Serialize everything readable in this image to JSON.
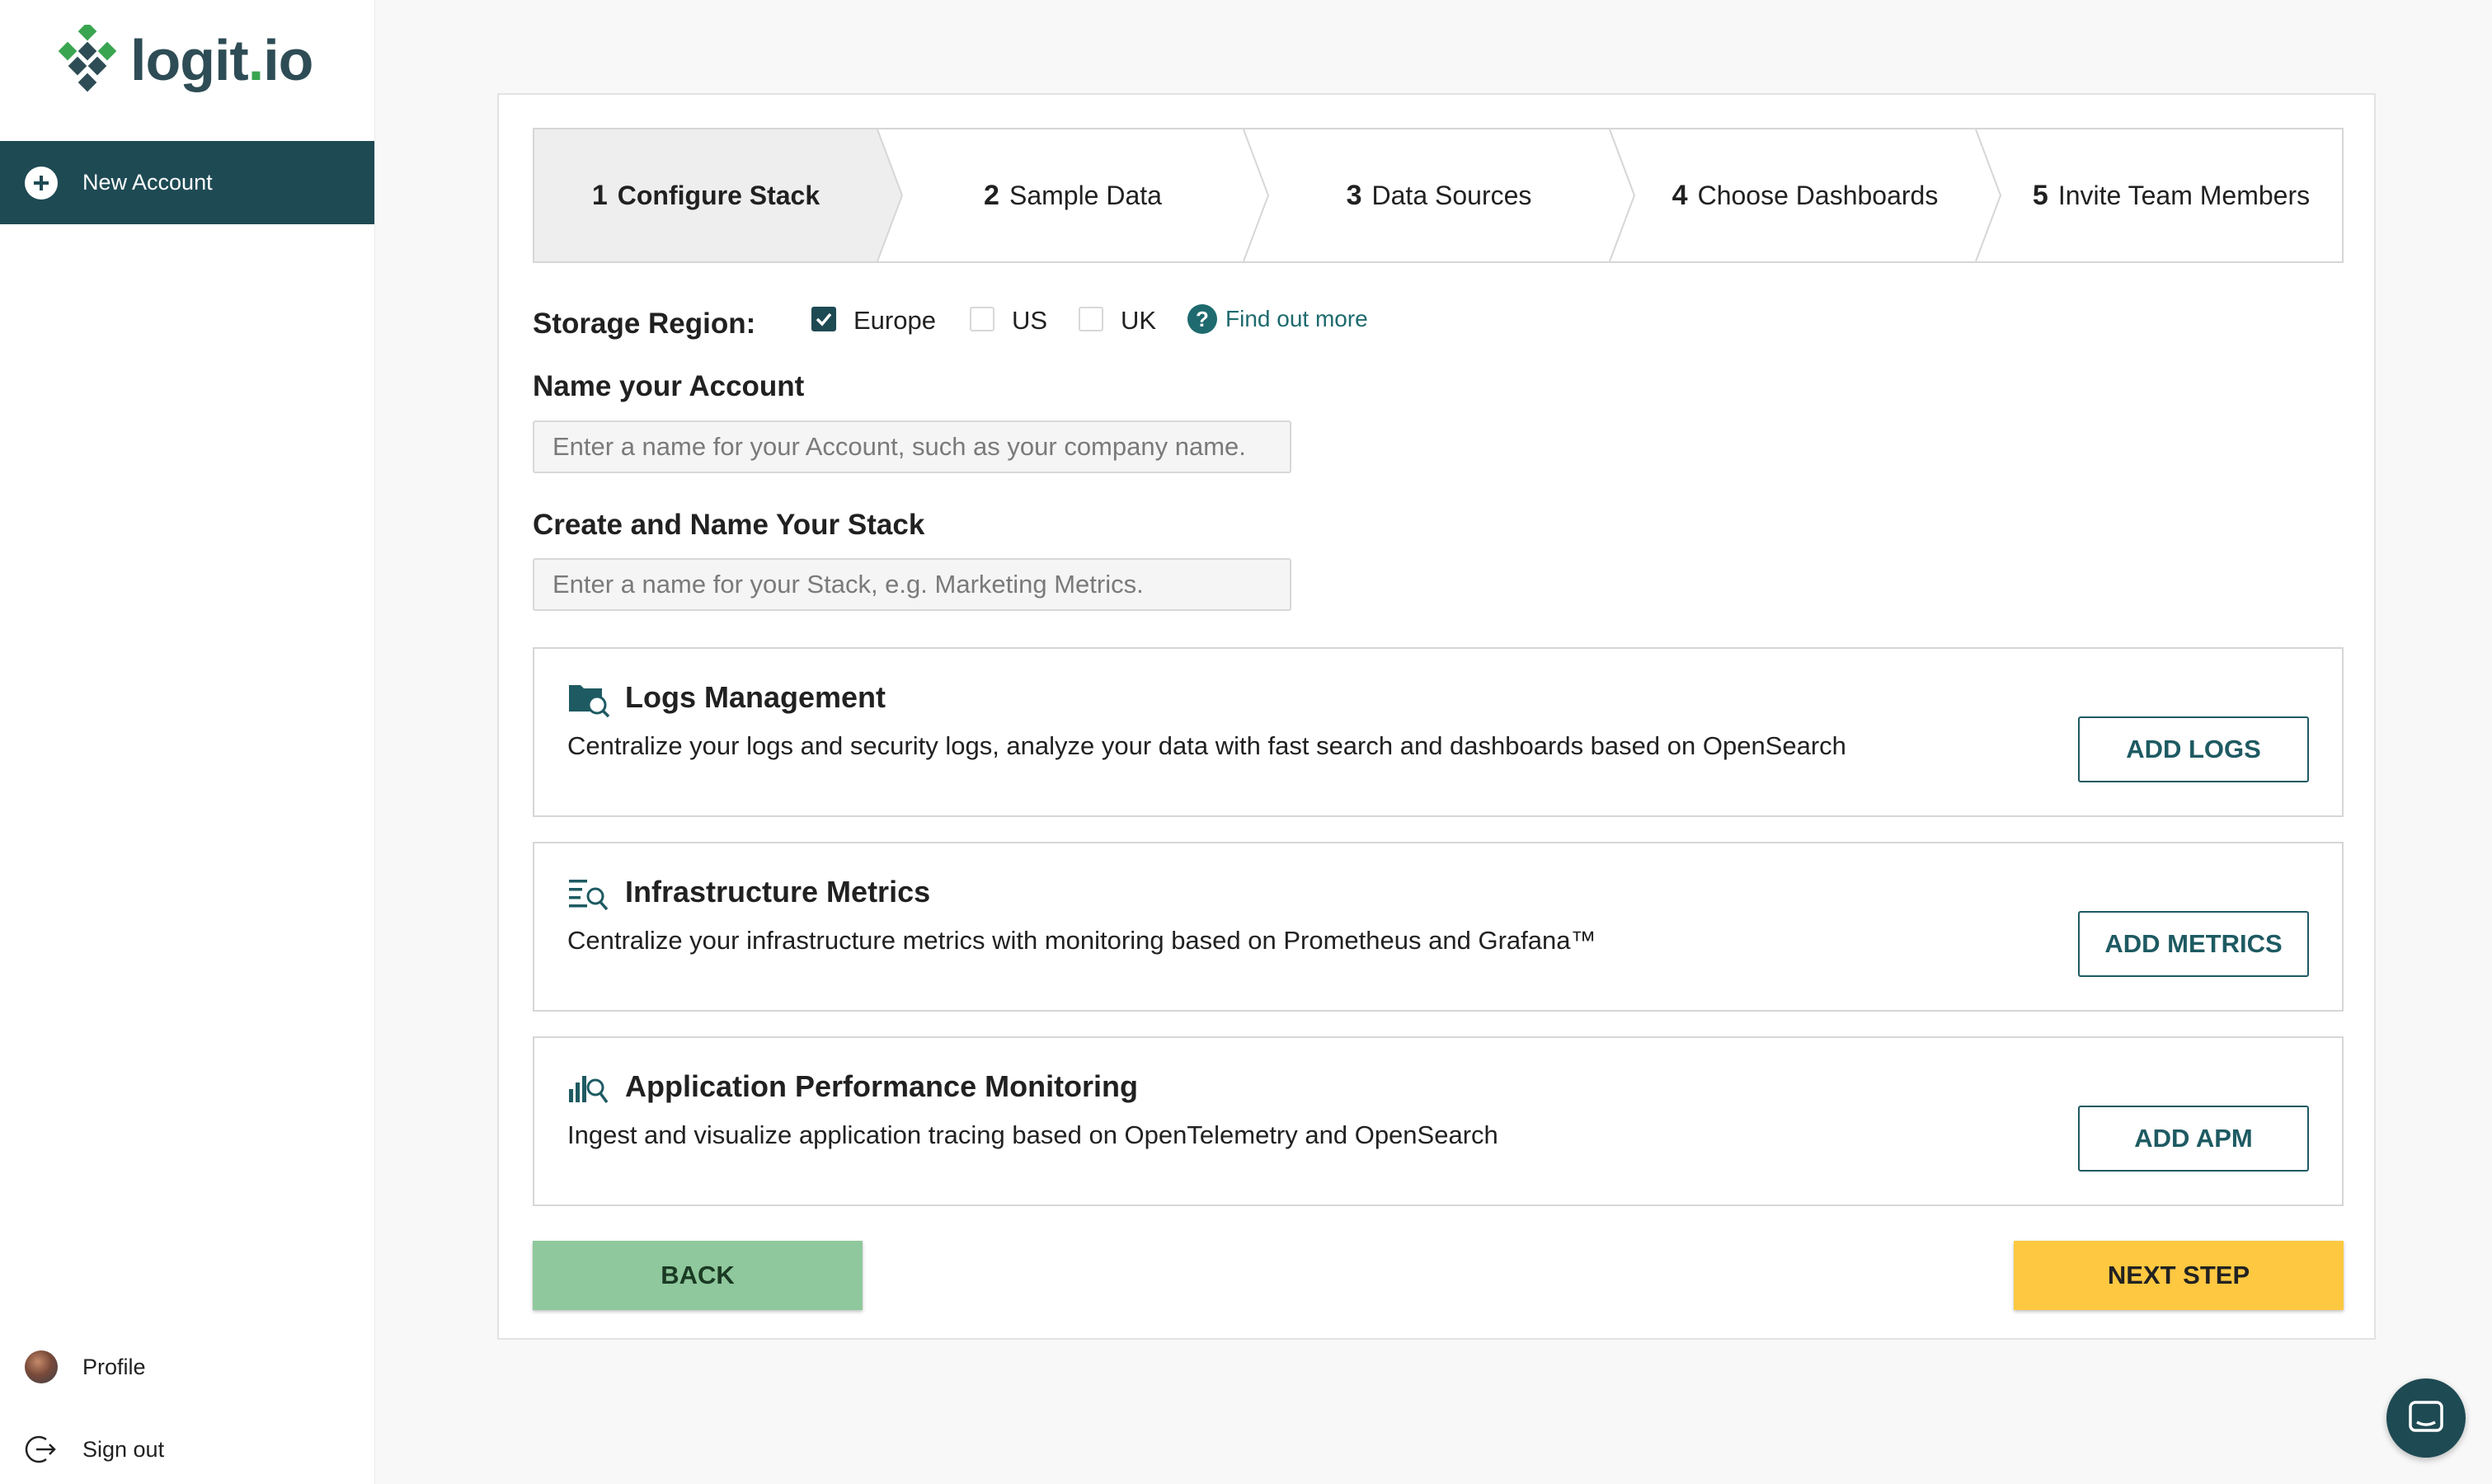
{
  "brand": {
    "logo_main": "logit",
    "logo_dot": ".",
    "logo_suffix": "io",
    "accent": "#1e4a54",
    "green": "#3aa550"
  },
  "sidebar": {
    "active_item": {
      "label": "New Account",
      "icon": "plus-circle-icon"
    },
    "bottom_items": [
      {
        "label": "Profile",
        "icon": "avatar"
      },
      {
        "label": "Sign out",
        "icon": "sign-out-icon"
      }
    ]
  },
  "stepper": {
    "steps": [
      {
        "num": "1",
        "label": "Configure Stack",
        "active": true
      },
      {
        "num": "2",
        "label": "Sample Data",
        "active": false
      },
      {
        "num": "3",
        "label": "Data Sources",
        "active": false
      },
      {
        "num": "4",
        "label": "Choose Dashboards",
        "active": false
      },
      {
        "num": "5",
        "label": "Invite Team Members",
        "active": false
      }
    ]
  },
  "storage": {
    "label": "Storage Region:",
    "options": [
      {
        "label": "Europe",
        "checked": true
      },
      {
        "label": "US",
        "checked": false
      },
      {
        "label": "UK",
        "checked": false
      }
    ],
    "help_link": "Find out more"
  },
  "account": {
    "label": "Name your Account",
    "placeholder": "Enter a name for your Account, such as your company name.",
    "value": ""
  },
  "stack": {
    "label": "Create and Name Your Stack",
    "placeholder": "Enter a name for your Stack, e.g. Marketing Metrics.",
    "value": ""
  },
  "features": [
    {
      "title": "Logs Management",
      "description": "Centralize your logs and security logs, analyze your data with fast search and dashboards based on OpenSearch",
      "button": "ADD LOGS",
      "icon": "folder-search-icon"
    },
    {
      "title": "Infrastructure Metrics",
      "description": "Centralize your infrastructure metrics with monitoring based on Prometheus and Grafana™",
      "button": "ADD METRICS",
      "icon": "list-search-icon"
    },
    {
      "title": "Application Performance Monitoring",
      "description": "Ingest and visualize application tracing based on OpenTelemetry and OpenSearch",
      "button": "ADD APM",
      "icon": "chart-search-icon"
    }
  ],
  "actions": {
    "back": "BACK",
    "next": "NEXT STEP",
    "back_color": "#8fc89c",
    "next_color": "#fec841"
  },
  "chat": {
    "icon": "chat-icon"
  }
}
